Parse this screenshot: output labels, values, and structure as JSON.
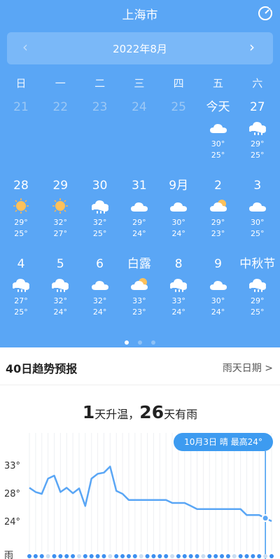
{
  "city": "上海市",
  "month_title": "2022年8月",
  "weekdays": [
    "日",
    "一",
    "二",
    "三",
    "四",
    "五",
    "六"
  ],
  "weeks": [
    [
      {
        "d": "21",
        "muted": true
      },
      {
        "d": "22",
        "muted": true
      },
      {
        "d": "23",
        "muted": true
      },
      {
        "d": "24",
        "muted": true
      },
      {
        "d": "25",
        "muted": true
      },
      {
        "d": "今天",
        "icon": "cloud",
        "hi": "30°",
        "lo": "25°"
      },
      {
        "d": "27",
        "icon": "rain",
        "hi": "29°",
        "lo": "25°"
      }
    ],
    [
      {
        "d": "28",
        "icon": "sun",
        "hi": "29°",
        "lo": "25°"
      },
      {
        "d": "29",
        "icon": "sun",
        "hi": "32°",
        "lo": "27°"
      },
      {
        "d": "30",
        "icon": "rain",
        "hi": "32°",
        "lo": "25°"
      },
      {
        "d": "31",
        "icon": "cloud",
        "hi": "29°",
        "lo": "24°"
      },
      {
        "d": "9月",
        "icon": "cloud",
        "hi": "30°",
        "lo": "24°"
      },
      {
        "d": "2",
        "icon": "partly",
        "hi": "29°",
        "lo": "23°"
      },
      {
        "d": "3",
        "icon": "cloud",
        "hi": "30°",
        "lo": "25°"
      }
    ],
    [
      {
        "d": "4",
        "icon": "rain",
        "hi": "27°",
        "lo": "25°"
      },
      {
        "d": "5",
        "icon": "rain",
        "hi": "32°",
        "lo": "24°"
      },
      {
        "d": "6",
        "icon": "cloud",
        "hi": "32°",
        "lo": "24°"
      },
      {
        "d": "白露",
        "icon": "partly",
        "hi": "33°",
        "lo": "23°"
      },
      {
        "d": "8",
        "icon": "rain",
        "hi": "33°",
        "lo": "24°"
      },
      {
        "d": "9",
        "icon": "cloud",
        "hi": "30°",
        "lo": "24°"
      },
      {
        "d": "中秋节",
        "icon": "rain",
        "hi": "29°",
        "lo": "25°"
      }
    ]
  ],
  "section": {
    "title": "40日趋势预报",
    "link": "雨天日期 >"
  },
  "summary": {
    "n1": "1",
    "t1": "天升温，",
    "n2": "26",
    "t2": "天有雨"
  },
  "badge": "10月3日 晴 最高24°",
  "colors": {
    "bg": "#5aa6f5",
    "accent": "#3d9bf0"
  },
  "chart_data": {
    "type": "line",
    "y_ticks": [
      "33°",
      "28°",
      "24°"
    ],
    "rain_label": "雨",
    "x": [
      1,
      2,
      3,
      4,
      5,
      6,
      7,
      8,
      9,
      10,
      11,
      12,
      13,
      14,
      15,
      16,
      17,
      18,
      19,
      20,
      21,
      22,
      23,
      24,
      25,
      26,
      27,
      28,
      29,
      30,
      31,
      32,
      33,
      34,
      35,
      36,
      37,
      38,
      39,
      40
    ],
    "values": [
      29.5,
      28.8,
      28.5,
      31,
      31.5,
      28.8,
      29.5,
      28.6,
      29.4,
      26.5,
      31,
      31.8,
      32,
      33,
      29,
      28.5,
      27.5,
      27.5,
      27.5,
      27.5,
      27.5,
      27.5,
      27.5,
      27,
      27,
      27,
      26.5,
      26,
      26,
      26,
      26,
      26,
      26,
      26,
      26,
      25,
      25,
      25,
      24.5,
      24
    ],
    "ylim": [
      24,
      33
    ]
  }
}
